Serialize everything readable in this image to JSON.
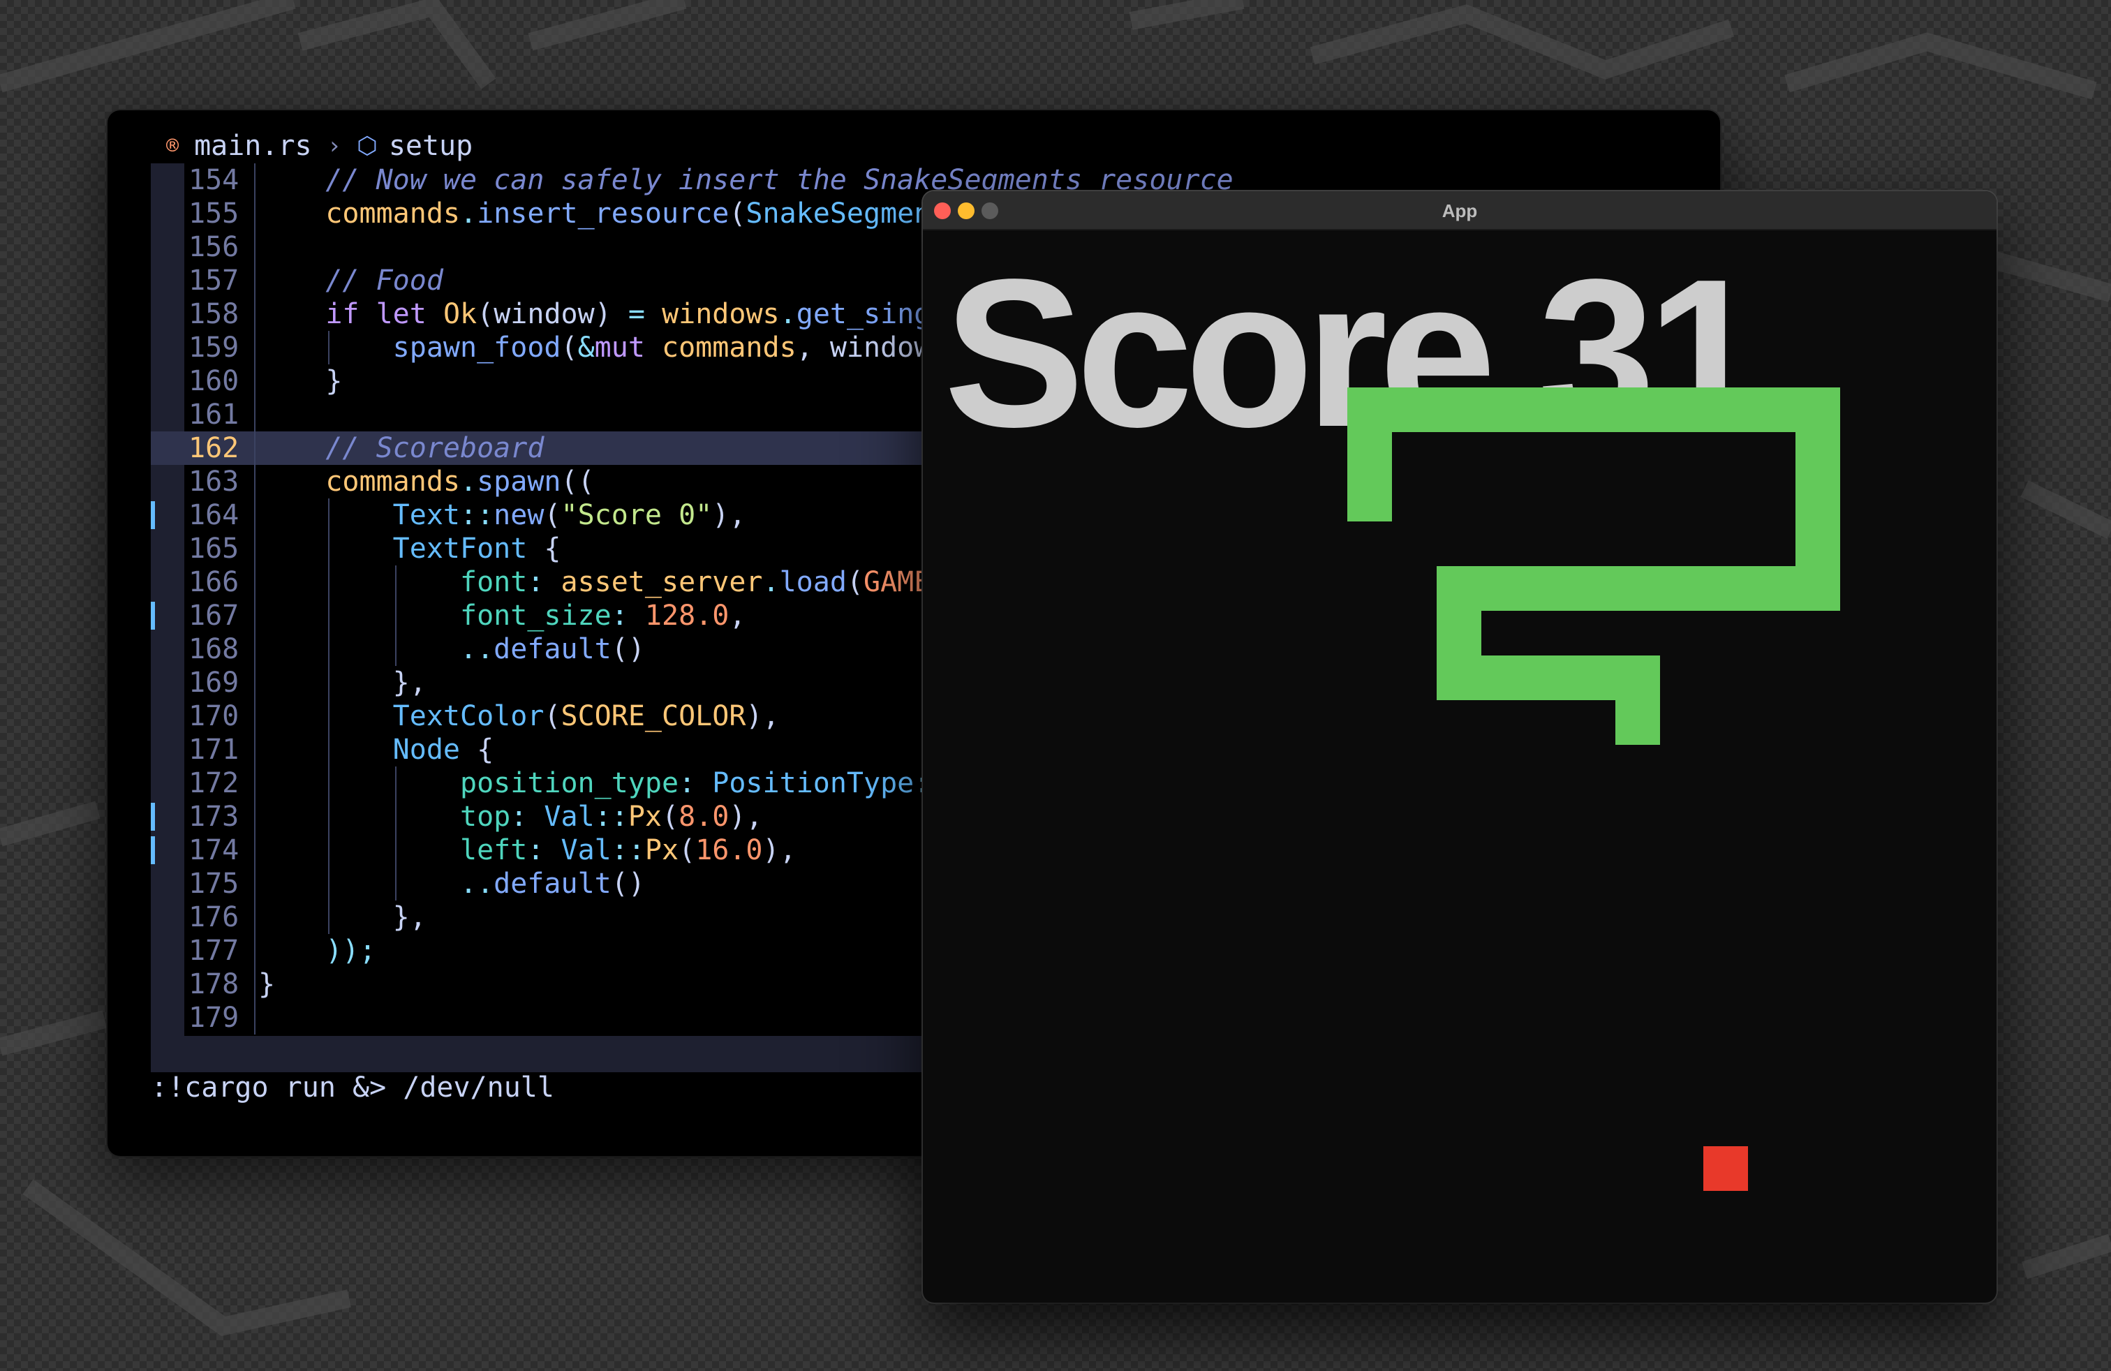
{
  "editor": {
    "breadcrumb": {
      "file": "main.rs",
      "symbol": "setup",
      "file_icon": "rust-icon",
      "symbol_icon": "cube-icon"
    },
    "current_line": 162,
    "lines": [
      {
        "n": "154",
        "tokens": [
          [
            "    ",
            "c"
          ],
          [
            "// Now we can safely insert the SnakeSegments resource",
            "com"
          ]
        ]
      },
      {
        "n": "155",
        "tokens": [
          [
            "    ",
            "c"
          ],
          [
            "commands",
            "var"
          ],
          [
            ".",
            "punc"
          ],
          [
            "insert_resource",
            "fn"
          ],
          [
            "(",
            "c"
          ],
          [
            "SnakeSegments",
            "ty"
          ]
        ]
      },
      {
        "n": "156",
        "tokens": []
      },
      {
        "n": "157",
        "tokens": [
          [
            "    ",
            "c"
          ],
          [
            "// Food",
            "com"
          ]
        ]
      },
      {
        "n": "158",
        "tokens": [
          [
            "    ",
            "c"
          ],
          [
            "if",
            "kw"
          ],
          [
            " ",
            "c"
          ],
          [
            "let",
            "kw"
          ],
          [
            " ",
            "c"
          ],
          [
            "Ok",
            "var"
          ],
          [
            "(",
            "c"
          ],
          [
            "window",
            "c"
          ],
          [
            ") ",
            "c"
          ],
          [
            "=",
            "op"
          ],
          [
            " ",
            "c"
          ],
          [
            "windows",
            "var"
          ],
          [
            ".",
            "punc"
          ],
          [
            "get_single",
            "fn"
          ]
        ]
      },
      {
        "n": "159",
        "tokens": [
          [
            "        ",
            "c"
          ],
          [
            "spawn_food",
            "fn"
          ],
          [
            "(",
            "c"
          ],
          [
            "&",
            "op"
          ],
          [
            "mut",
            "kw"
          ],
          [
            " ",
            "c"
          ],
          [
            "commands",
            "var"
          ],
          [
            ", ",
            "c"
          ],
          [
            "window",
            "c"
          ]
        ]
      },
      {
        "n": "160",
        "tokens": [
          [
            "    ",
            "c"
          ],
          [
            "}",
            "c"
          ]
        ]
      },
      {
        "n": "161",
        "tokens": []
      },
      {
        "n": "162",
        "tokens": [
          [
            "    ",
            "c"
          ],
          [
            "// Scoreboard",
            "com"
          ]
        ]
      },
      {
        "n": "163",
        "tokens": [
          [
            "    ",
            "c"
          ],
          [
            "commands",
            "var"
          ],
          [
            ".",
            "punc"
          ],
          [
            "spawn",
            "fn"
          ],
          [
            "((",
            "c"
          ]
        ]
      },
      {
        "n": "164",
        "tokens": [
          [
            "        ",
            "c"
          ],
          [
            "Text",
            "ty"
          ],
          [
            "::",
            "punc"
          ],
          [
            "new",
            "fn"
          ],
          [
            "(",
            "c"
          ],
          [
            "\"Score 0\"",
            "str"
          ],
          [
            "),",
            "c"
          ]
        ]
      },
      {
        "n": "165",
        "tokens": [
          [
            "        ",
            "c"
          ],
          [
            "TextFont",
            "ty"
          ],
          [
            " {",
            "c"
          ]
        ]
      },
      {
        "n": "166",
        "tokens": [
          [
            "            ",
            "c"
          ],
          [
            "font",
            "prop"
          ],
          [
            ":",
            "punc"
          ],
          [
            " ",
            "c"
          ],
          [
            "asset_server",
            "var"
          ],
          [
            ".",
            "punc"
          ],
          [
            "load",
            "fn"
          ],
          [
            "(",
            "c"
          ],
          [
            "GAME",
            "num"
          ]
        ]
      },
      {
        "n": "167",
        "tokens": [
          [
            "            ",
            "c"
          ],
          [
            "font_size",
            "prop"
          ],
          [
            ":",
            "punc"
          ],
          [
            " ",
            "c"
          ],
          [
            "128.0",
            "num"
          ],
          [
            ",",
            "c"
          ]
        ]
      },
      {
        "n": "168",
        "tokens": [
          [
            "            ",
            "c"
          ],
          [
            "..",
            "op"
          ],
          [
            "default",
            "fn"
          ],
          [
            "()",
            "c"
          ]
        ]
      },
      {
        "n": "169",
        "tokens": [
          [
            "        ",
            "c"
          ],
          [
            "},",
            "c"
          ]
        ]
      },
      {
        "n": "170",
        "tokens": [
          [
            "        ",
            "c"
          ],
          [
            "TextColor",
            "ty"
          ],
          [
            "(",
            "c"
          ],
          [
            "SCORE_COLOR",
            "var"
          ],
          [
            "),",
            "c"
          ]
        ]
      },
      {
        "n": "171",
        "tokens": [
          [
            "        ",
            "c"
          ],
          [
            "Node",
            "ty"
          ],
          [
            " {",
            "c"
          ]
        ]
      },
      {
        "n": "172",
        "tokens": [
          [
            "            ",
            "c"
          ],
          [
            "position_type",
            "prop"
          ],
          [
            ":",
            "punc"
          ],
          [
            " ",
            "c"
          ],
          [
            "PositionType",
            "ty"
          ],
          [
            ":",
            "punc"
          ]
        ]
      },
      {
        "n": "173",
        "tokens": [
          [
            "            ",
            "c"
          ],
          [
            "top",
            "prop"
          ],
          [
            ":",
            "punc"
          ],
          [
            " ",
            "c"
          ],
          [
            "Val",
            "ty"
          ],
          [
            "::",
            "punc"
          ],
          [
            "Px",
            "var"
          ],
          [
            "(",
            "c"
          ],
          [
            "8.0",
            "num"
          ],
          [
            "),",
            "c"
          ]
        ]
      },
      {
        "n": "174",
        "tokens": [
          [
            "            ",
            "c"
          ],
          [
            "left",
            "prop"
          ],
          [
            ":",
            "punc"
          ],
          [
            " ",
            "c"
          ],
          [
            "Val",
            "ty"
          ],
          [
            "::",
            "punc"
          ],
          [
            "Px",
            "var"
          ],
          [
            "(",
            "c"
          ],
          [
            "16.0",
            "num"
          ],
          [
            "),",
            "c"
          ]
        ]
      },
      {
        "n": "175",
        "tokens": [
          [
            "            ",
            "c"
          ],
          [
            "..",
            "op"
          ],
          [
            "default",
            "fn"
          ],
          [
            "()",
            "c"
          ]
        ]
      },
      {
        "n": "176",
        "tokens": [
          [
            "        ",
            "c"
          ],
          [
            "},",
            "c"
          ]
        ]
      },
      {
        "n": "177",
        "tokens": [
          [
            "    ",
            "c"
          ],
          [
            "));",
            "punc"
          ]
        ]
      },
      {
        "n": "178",
        "tokens": [
          [
            "}",
            "c"
          ]
        ]
      },
      {
        "n": "179",
        "tokens": []
      }
    ],
    "command_line": ":!cargo run &> /dev/null"
  },
  "app": {
    "title": "App",
    "score_text": "Score 31",
    "colors": {
      "snake": "#63c95a",
      "food": "#e8392a",
      "score": "#cdcdcd",
      "background": "#0b0b0b"
    }
  }
}
